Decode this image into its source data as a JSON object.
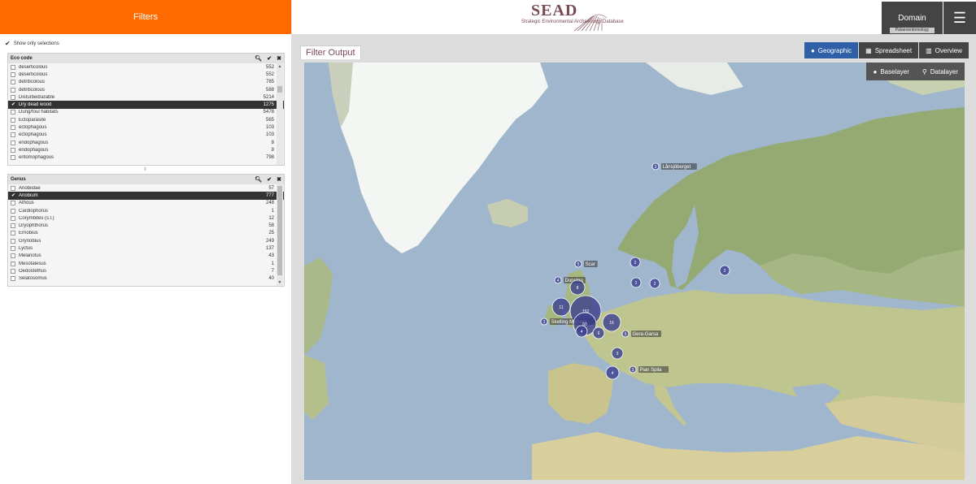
{
  "left": {
    "filters_title": "Filters",
    "show_only": "Show only selections",
    "eco": {
      "title": "Eco code",
      "items": [
        {
          "label": "deserticolous",
          "count": "552",
          "selected": false
        },
        {
          "label": "deserticolous",
          "count": "552",
          "selected": false
        },
        {
          "label": "detriticolous",
          "count": "785",
          "selected": false
        },
        {
          "label": "detriticolous",
          "count": "588",
          "selected": false
        },
        {
          "label": "Disturbed/arable",
          "count": "5214",
          "selected": false
        },
        {
          "label": "Dry dead wood",
          "count": "1275",
          "selected": true
        },
        {
          "label": "Dung/foul habitats",
          "count": "5478",
          "selected": false
        },
        {
          "label": "Ectoparasite",
          "count": "565",
          "selected": false
        },
        {
          "label": "ectophagous",
          "count": "103",
          "selected": false
        },
        {
          "label": "ectophagous",
          "count": "103",
          "selected": false
        },
        {
          "label": "endophagous",
          "count": "8",
          "selected": false
        },
        {
          "label": "endophagous",
          "count": "8",
          "selected": false
        },
        {
          "label": "entomophagous",
          "count": "798",
          "selected": false
        }
      ]
    },
    "genus": {
      "title": "Genus",
      "items": [
        {
          "label": "Anobiidae",
          "count": "57",
          "selected": false
        },
        {
          "label": "Anobium",
          "count": "777",
          "selected": true
        },
        {
          "label": "Athous",
          "count": "248",
          "selected": false
        },
        {
          "label": "Cardiophorus",
          "count": "1",
          "selected": false
        },
        {
          "label": "Corymbites (s.l.)",
          "count": "12",
          "selected": false
        },
        {
          "label": "Dryophthorus",
          "count": "58",
          "selected": false
        },
        {
          "label": "Ernobius",
          "count": "25",
          "selected": false
        },
        {
          "label": "Grynobius",
          "count": "249",
          "selected": false
        },
        {
          "label": "Lyctus",
          "count": "137",
          "selected": false
        },
        {
          "label": "Melanotus",
          "count": "43",
          "selected": false
        },
        {
          "label": "Mesotalesus",
          "count": "1",
          "selected": false
        },
        {
          "label": "Oedostethus",
          "count": "7",
          "selected": false
        },
        {
          "label": "Selatosomus",
          "count": "40",
          "selected": false
        }
      ]
    }
  },
  "header": {
    "logo_title": "SEAD",
    "logo_subtitle": "Strategic Environmental Archaeology Database",
    "domain_label": "Domain",
    "domain_value": "Palaeoentomology"
  },
  "main": {
    "tab_title": "Filter Output",
    "view_tabs": [
      {
        "label": "Geographic",
        "active": true
      },
      {
        "label": "Spreadsheet",
        "active": false
      },
      {
        "label": "Overview",
        "active": false
      }
    ],
    "layer_buttons": [
      "Baselayer",
      "Datalayer"
    ]
  },
  "map": {
    "colors": {
      "ocean": "#9fb6cd",
      "land": "#b9c48f",
      "forest": "#8fa870",
      "ice": "#f4f6f4",
      "marker": "#3b3f8e"
    },
    "markers": [
      {
        "count": "3",
        "label": "Lånsjöberget"
      },
      {
        "count": "5",
        "label": "Scar"
      },
      {
        "count": "2",
        "label": ""
      },
      {
        "count": "2",
        "label": ""
      },
      {
        "count": "2",
        "label": ""
      },
      {
        "count": "2",
        "label": ""
      },
      {
        "count": "4",
        "label": "Dunstan"
      },
      {
        "count": "8",
        "label": ""
      },
      {
        "count": "11",
        "label": ""
      },
      {
        "count": "152",
        "label": ""
      },
      {
        "count": "3",
        "label": "Skelling Michael"
      },
      {
        "count": "60",
        "label": ""
      },
      {
        "count": "4",
        "label": ""
      },
      {
        "count": "16",
        "label": ""
      },
      {
        "count": "6",
        "label": ""
      },
      {
        "count": "5",
        "label": "Gera-Garsa"
      },
      {
        "count": "3",
        "label": ""
      },
      {
        "count": "3",
        "label": "Pian Spila"
      },
      {
        "count": "4",
        "label": ""
      }
    ]
  }
}
